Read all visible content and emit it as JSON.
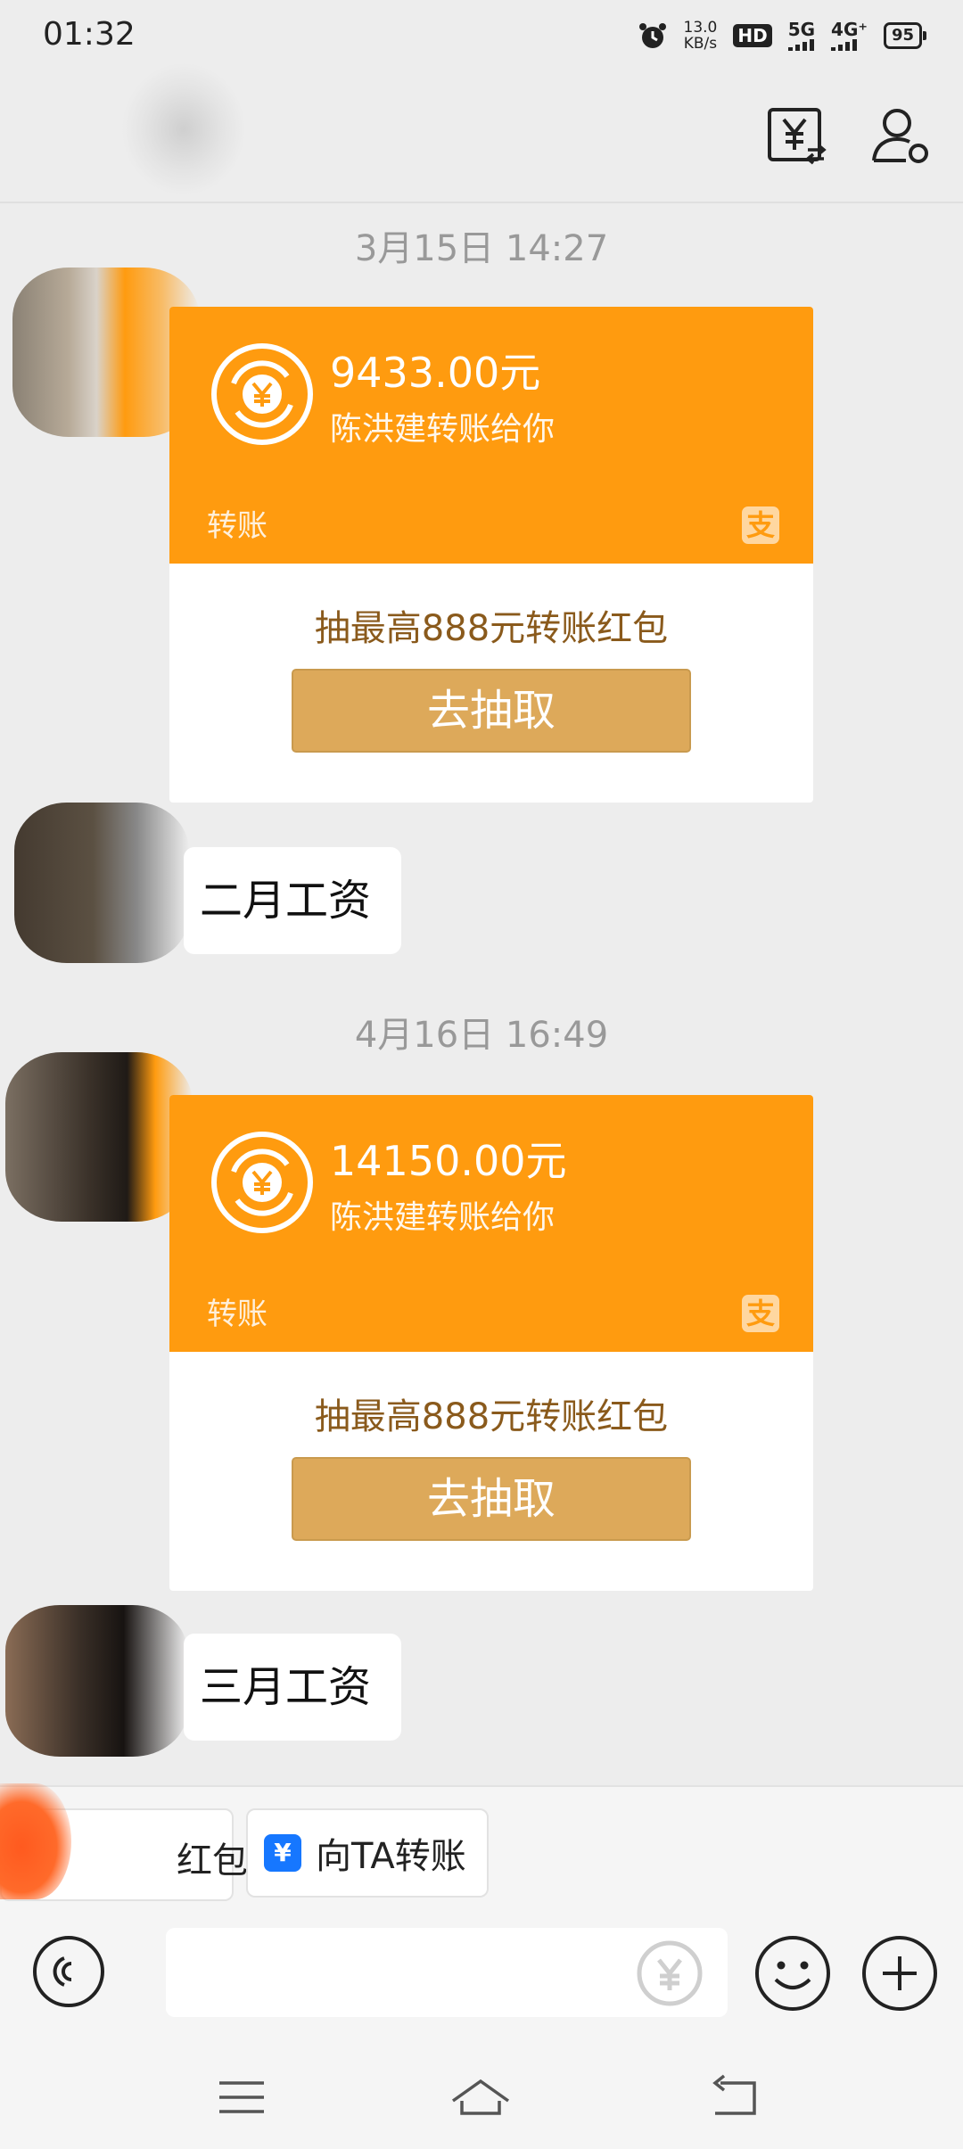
{
  "status_bar": {
    "time": "01:32",
    "speed_value": "13.0",
    "speed_unit": "KB/s",
    "hd": "HD",
    "sim1": "5G",
    "sim2": "4G⁺",
    "battery": "95"
  },
  "header": {
    "transfer_icon": "yuan-transfer-icon",
    "profile_icon": "person-settings-icon"
  },
  "messages": [
    {
      "time": "3月15日 14:27",
      "amount": "9433.00元",
      "desc": "陈洪建转账给你",
      "type": "转账",
      "promo": "抽最高888元转账红包",
      "button": "去抽取"
    },
    {
      "text": "二月工资"
    },
    {
      "time": "4月16日 16:49",
      "amount": "14150.00元",
      "desc": "陈洪建转账给你",
      "type": "转账",
      "promo": "抽最高888元转账红包",
      "button": "去抽取"
    },
    {
      "text": "三月工资"
    }
  ],
  "quick_actions": {
    "red_packet": "红包",
    "transfer": "向TA转账",
    "transfer_icon_glyph": "¥"
  },
  "colors": {
    "card_orange": "#ff9b0f",
    "button_gold": "#dda95a",
    "promo_brown": "#8a5a1c",
    "alipay_blue": "#1677ff"
  },
  "icons": {
    "pay_glyph": "支",
    "coin_glyph": "¥"
  }
}
